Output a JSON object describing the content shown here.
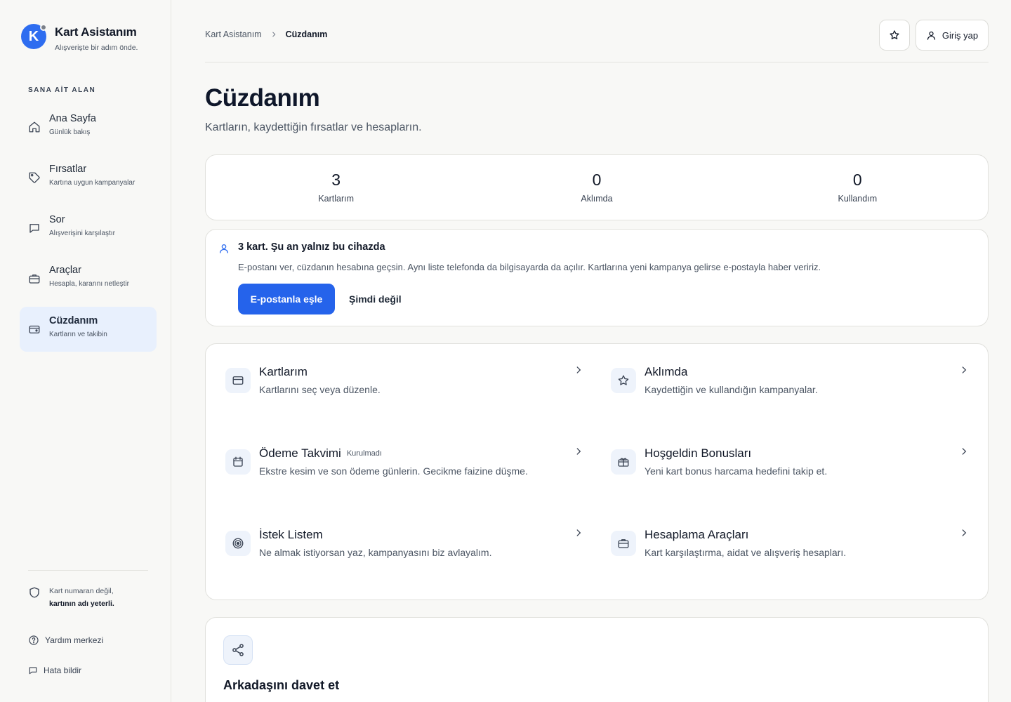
{
  "brand": {
    "logo_letter": "K",
    "title": "Kart Asistanım",
    "subtitle": "Alışverişte bir adım önde."
  },
  "sidebar": {
    "section_label": "SANA AİT ALAN",
    "items": [
      {
        "label": "Ana Sayfa",
        "sub": "Günlük bakış",
        "icon": "home-icon"
      },
      {
        "label": "Fırsatlar",
        "sub": "Kartına uygun kampanyalar",
        "icon": "tag-icon"
      },
      {
        "label": "Sor",
        "sub": "Alışverişini karşılaştır",
        "icon": "chat-icon"
      },
      {
        "label": "Araçlar",
        "sub": "Hesapla, kararını netleştir",
        "icon": "briefcase-icon"
      },
      {
        "label": "Cüzdanım",
        "sub": "Kartların ve takibin",
        "icon": "wallet-icon",
        "active": true
      }
    ],
    "secure_line1": "Kart numaran değil,",
    "secure_line2": "kartının adı yeterli.",
    "help": "Yardım merkezi",
    "report": "Hata bildir"
  },
  "header": {
    "breadcrumb_root": "Kart Asistanım",
    "breadcrumb_current": "Cüzdanım",
    "login_label": "Giriş yap"
  },
  "page": {
    "title": "Cüzdanım",
    "subtitle": "Kartların, kaydettiğin fırsatlar ve hesapların."
  },
  "stats": [
    {
      "value": "3",
      "label": "Kartlarım"
    },
    {
      "value": "0",
      "label": "Aklımda"
    },
    {
      "value": "0",
      "label": "Kullandım"
    }
  ],
  "sync": {
    "title": "3 kart. Şu an yalnız bu cihazda",
    "text": "E-postanı ver, cüzdanın hesabına geçsin. Aynı liste telefonda da bilgisayarda da açılır. Kartlarına yeni kampanya gelirse e-postayla haber veririz.",
    "primary_label": "E-postanla eşle",
    "secondary_label": "Şimdi değil"
  },
  "tools": [
    {
      "title": "Kartlarım",
      "desc": "Kartlarını seç veya düzenle.",
      "icon": "credit-card-icon",
      "badge": ""
    },
    {
      "title": "Aklımda",
      "desc": "Kaydettiğin ve kullandığın kampanyalar.",
      "icon": "star-icon",
      "badge": ""
    },
    {
      "title": "Ödeme Takvimi",
      "desc": "Ekstre kesim ve son ödeme günlerin. Gecikme faizine düşme.",
      "icon": "calendar-icon",
      "badge": "Kurulmadı"
    },
    {
      "title": "Hoşgeldin Bonusları",
      "desc": "Yeni kart bonus harcama hedefini takip et.",
      "icon": "gift-icon",
      "badge": ""
    },
    {
      "title": "İstek Listem",
      "desc": "Ne almak istiyorsan yaz, kampanyasını biz avlayalım.",
      "icon": "target-icon",
      "badge": ""
    },
    {
      "title": "Hesaplama Araçları",
      "desc": "Kart karşılaştırma, aidat ve alışveriş hesapları.",
      "icon": "briefcase-icon",
      "badge": ""
    }
  ],
  "invite": {
    "title": "Arkadaşını davet et",
    "icon": "share-icon"
  },
  "colors": {
    "accent": "#2563eb",
    "active_bg": "#e8f0fd",
    "page_bg": "#f8f8f6"
  }
}
